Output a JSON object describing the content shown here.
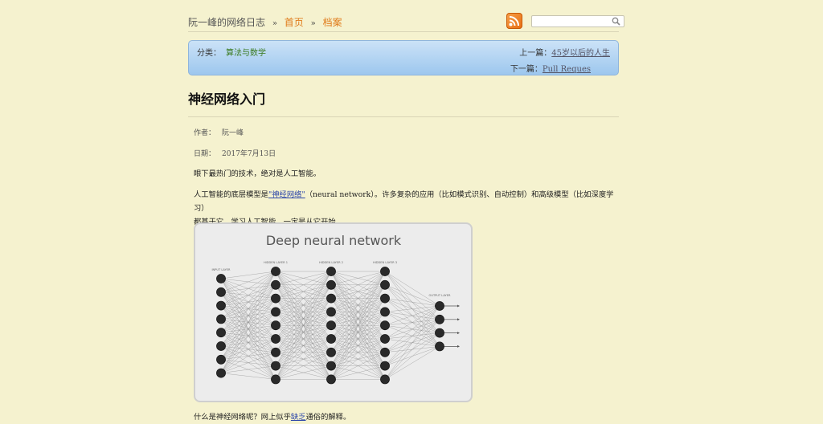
{
  "header": {
    "blog_name": "阮一峰的网络日志",
    "sep": "»",
    "nav": [
      "首页",
      "档案"
    ],
    "rss_icon": "rss-icon",
    "search_placeholder": ""
  },
  "category_box": {
    "category_label": "分类：",
    "category": "算法与数学",
    "prev_label": "上一篇：",
    "prev_title": "45岁以后的人生",
    "next_label": "下一篇：",
    "next_title": "Pull Reques"
  },
  "article": {
    "title": "神经网络入门",
    "author_label": "作者：",
    "author": "阮一峰",
    "date_label": "日期：",
    "date": "2017年7月13日",
    "p1": "眼下最热门的技术，绝对是人工智能。",
    "p2_pre": "人工智能的底层模型是",
    "p2_link": "\"神经网络\"",
    "p2_post": "（neural network）。许多复杂的应用（比如模式识别、自动控制）和高级模型（比如深度学习）",
    "p2_line2": "都基于它。学习人工智能，一定是从它开始。",
    "p3_pre": "什么是神经网络呢？网上似乎",
    "p3_link": "缺乏",
    "p3_post": "通俗的解释。"
  },
  "figure": {
    "title": "Deep neural network",
    "layers": [
      {
        "label": "INPUT LAYER",
        "nodes": 8
      },
      {
        "label": "HIDDEN LAYER 1",
        "nodes": 9
      },
      {
        "label": "HIDDEN LAYER 2",
        "nodes": 9
      },
      {
        "label": "HIDDEN LAYER 3",
        "nodes": 9
      },
      {
        "label": "OUTPUT LAYER",
        "nodes": 4
      }
    ]
  }
}
